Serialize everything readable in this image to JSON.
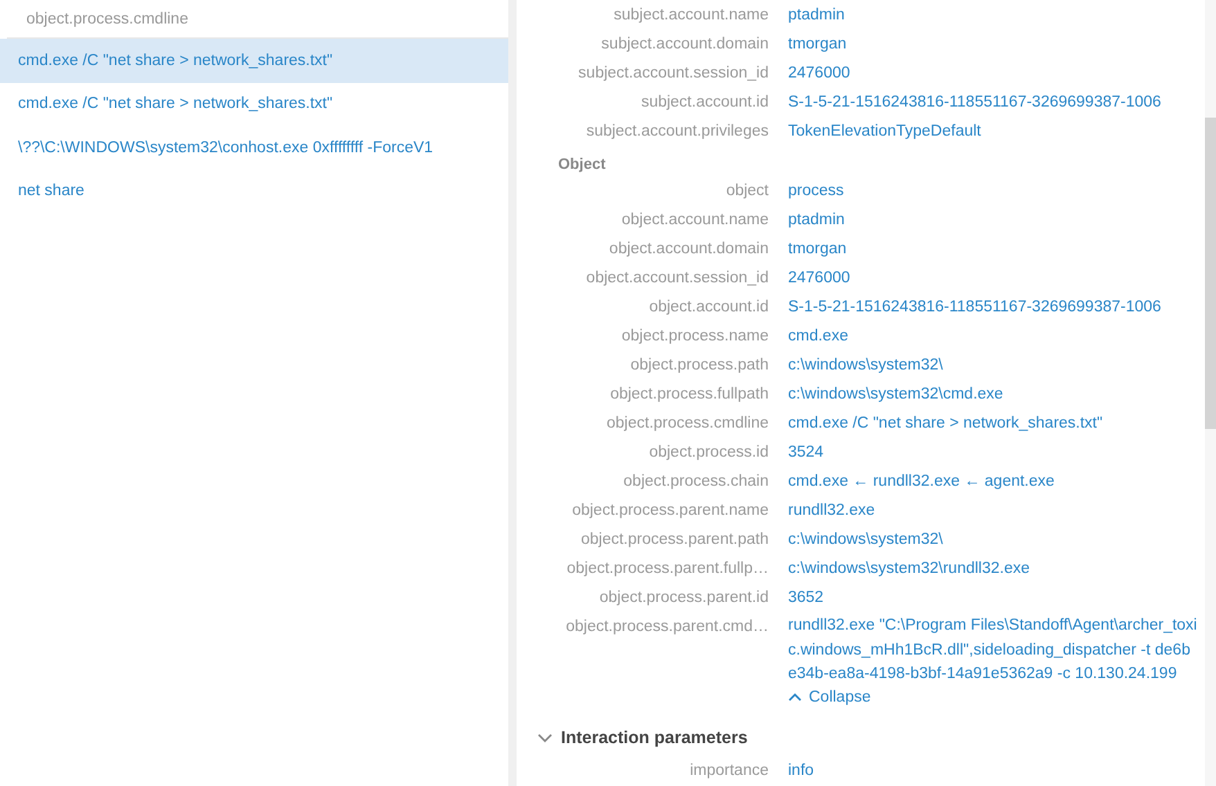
{
  "results_list": {
    "header": "object.process.cmdline",
    "items": [
      {
        "text": "cmd.exe /C \"net share > network_shares.txt\"",
        "selected": true
      },
      {
        "text": "cmd.exe /C \"net share > network_shares.txt\"",
        "selected": false
      },
      {
        "text": "\\??\\C:\\WINDOWS\\system32\\conhost.exe 0xffffffff -ForceV1",
        "selected": false
      },
      {
        "text": "net share",
        "selected": false
      }
    ]
  },
  "details": {
    "groups": [
      {
        "rows": [
          {
            "key": "subject.account.name",
            "value": "ptadmin"
          },
          {
            "key": "subject.account.domain",
            "value": "tmorgan"
          },
          {
            "key": "subject.account.session_id",
            "value": "2476000"
          },
          {
            "key": "subject.account.id",
            "value": "S-1-5-21-1516243816-118551167-3269699387-1006"
          },
          {
            "key": "subject.account.privileges",
            "value": "TokenElevationTypeDefault"
          }
        ]
      },
      {
        "title": "Object",
        "rows": [
          {
            "key": "object",
            "value": "process"
          },
          {
            "key": "object.account.name",
            "value": "ptadmin"
          },
          {
            "key": "object.account.domain",
            "value": "tmorgan"
          },
          {
            "key": "object.account.session_id",
            "value": "2476000"
          },
          {
            "key": "object.account.id",
            "value": "S-1-5-21-1516243816-118551167-3269699387-1006"
          },
          {
            "key": "object.process.name",
            "value": "cmd.exe"
          },
          {
            "key": "object.process.path",
            "value": "c:\\windows\\system32\\"
          },
          {
            "key": "object.process.fullpath",
            "value": "c:\\windows\\system32\\cmd.exe"
          },
          {
            "key": "object.process.cmdline",
            "value": "cmd.exe /C \"net share > network_shares.txt\""
          },
          {
            "key": "object.process.id",
            "value": "3524"
          },
          {
            "key": "object.process.chain",
            "value": "cmd.exe ← rundll32.exe ← agent.exe"
          },
          {
            "key": "object.process.parent.name",
            "value": "rundll32.exe"
          },
          {
            "key": "object.process.parent.path",
            "value": "c:\\windows\\system32\\"
          },
          {
            "key": "object.process.parent.fullp…",
            "value": "c:\\windows\\system32\\rundll32.exe"
          },
          {
            "key": "object.process.parent.id",
            "value": "3652"
          },
          {
            "key": "object.process.parent.cmd…",
            "value": "rundll32.exe \"C:\\Program Files\\Standoff\\Agent\\archer_toxic.windows_mHh1BcR.dll\",sideloading_dispatcher -t de6be34b-ea8a-4198-b3bf-14a91e5362a9 -c 10.130.24.199",
            "collapse": "Collapse"
          }
        ]
      }
    ],
    "sections": [
      {
        "title": "Interaction parameters",
        "expanded": true,
        "rows": [
          {
            "key": "importance",
            "value": "info"
          }
        ]
      }
    ]
  }
}
